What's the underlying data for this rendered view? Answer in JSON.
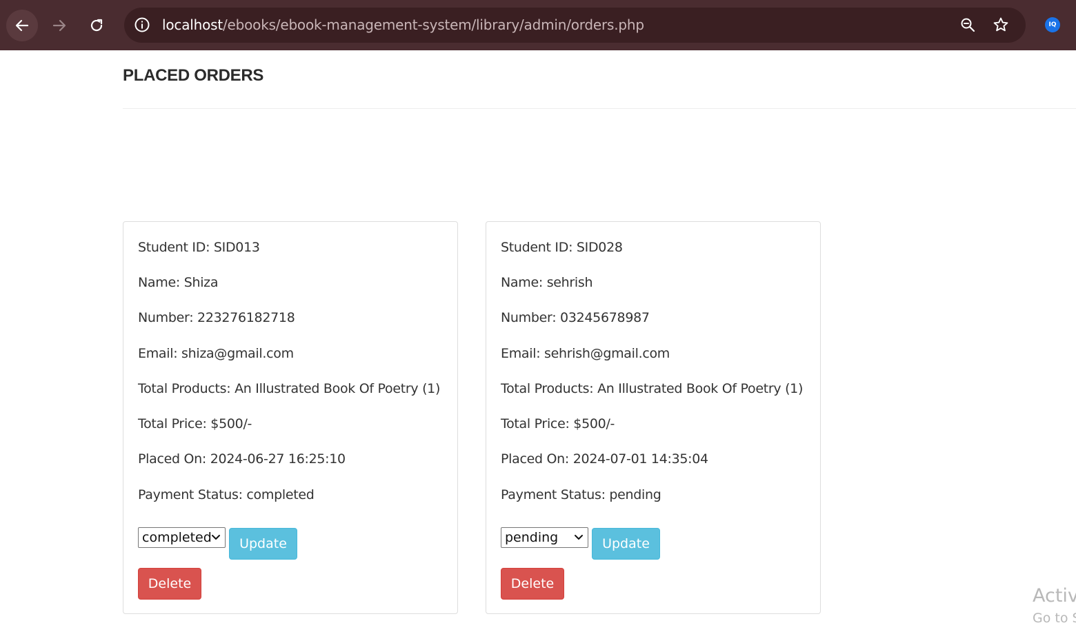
{
  "browser": {
    "url_host": "localhost",
    "url_path": "/ebooks/ebook-management-system/library/admin/orders.php",
    "extension_label": "IQ"
  },
  "page": {
    "title": "PLACED ORDERS"
  },
  "orders": [
    {
      "student_id": "Student ID: SID013",
      "name": "Name: Shiza",
      "number": "Number: 223276182718",
      "email": "Email: shiza@gmail.com",
      "total_products": "Total Products: An Illustrated Book Of Poetry (1)",
      "total_price": "Total Price: $500/-",
      "placed_on": "Placed On: 2024-06-27 16:25:10",
      "payment_status": "Payment Status: completed",
      "select_value": "completed",
      "update_label": "Update",
      "delete_label": "Delete"
    },
    {
      "student_id": "Student ID: SID028",
      "name": "Name: sehrish",
      "number": "Number: 03245678987",
      "email": "Email: sehrish@gmail.com",
      "total_products": "Total Products: An Illustrated Book Of Poetry (1)",
      "total_price": "Total Price: $500/-",
      "placed_on": "Placed On: 2024-07-01 14:35:04",
      "payment_status": "Payment Status: pending",
      "select_value": "pending",
      "update_label": "Update",
      "delete_label": "Delete"
    }
  ],
  "watermark": {
    "line1": "Activ",
    "line2": "Go to S"
  },
  "colors": {
    "browser_bar": "#4a2c30",
    "update_button": "#5bc0de",
    "delete_button": "#d9534f"
  }
}
